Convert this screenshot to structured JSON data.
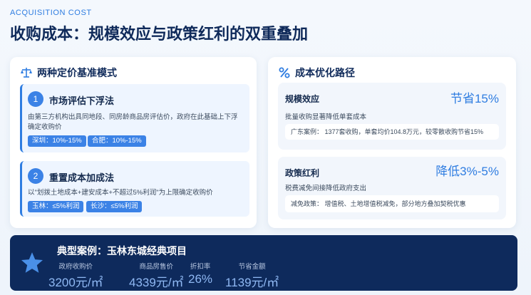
{
  "header": {
    "eyebrow": "ACQUISITION COST",
    "title": "收购成本：规模效应与政策红利的双重叠加"
  },
  "left_card": {
    "title": "两种定价基准模式",
    "icon": "scale-icon",
    "methods": [
      {
        "number": "1",
        "name": "市场评估下浮法",
        "desc": "由第三方机构出具同地段、同房龄商品房评估价，政府在此基础上下浮确定收购价",
        "tags": [
          "深圳：10%-15%",
          "合肥：10%-15%"
        ]
      },
      {
        "number": "2",
        "name": "重置成本加成法",
        "desc": "以\"划拨土地成本+建安成本+不超过5%利润\"为上限确定收购价",
        "tags": [
          "玉林：≤5%利润",
          "长沙：≤5%利润"
        ]
      }
    ]
  },
  "right_card": {
    "title": "成本优化路径",
    "icon": "percent-icon",
    "paths": [
      {
        "name": "规模效应",
        "highlight": "节省15%",
        "desc": "批量收购显著降低单套成本",
        "detail": "广东案例： 1377套收购，单套均价104.8万元，较零散收购节省15%"
      },
      {
        "name": "政策红利",
        "highlight": "降低3%-5%",
        "desc": "税费减免间接降低政府支出",
        "detail": "减免政策： 增值税、土地增值税减免，部分地方叠加契税优惠"
      }
    ]
  },
  "banner": {
    "title": "典型案例：玉林东城经典项目",
    "icon": "star-icon",
    "stats": [
      {
        "label": "政府收购价",
        "value": "3200元/㎡"
      },
      {
        "label": "商品房售价",
        "value": "4339元/㎡"
      },
      {
        "label": "折扣率",
        "value": "26%"
      },
      {
        "label": "节省金额",
        "value": "1139元/㎡"
      }
    ]
  },
  "colors": {
    "accent": "#2f7de1",
    "navy": "#0e2a5c",
    "tag": "#3b82e6"
  }
}
